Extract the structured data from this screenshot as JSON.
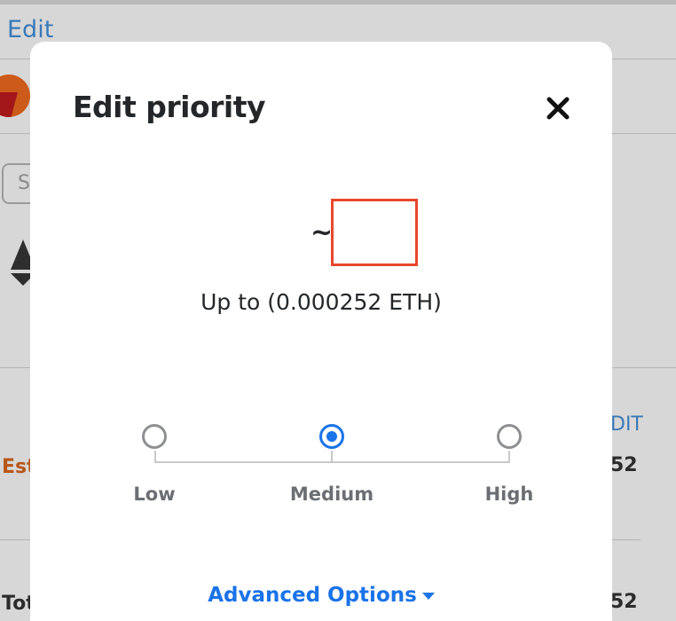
{
  "background": {
    "edit_link": "Edit",
    "search_fragment": "S",
    "estimated_fragment": "Est",
    "total_fragment": "Tot",
    "right_edit_fragment": "DIT",
    "right_value_1": "52",
    "right_value_2": "52",
    "icons": [
      "account-avatar-icon",
      "ethereum-icon"
    ]
  },
  "modal": {
    "title": "Edit priority",
    "close_icon": "close-icon",
    "fee_prefix": "~",
    "fee_max_label": "Up to (0.000252 ETH)",
    "priority_options": [
      {
        "label": "Low",
        "selected": false
      },
      {
        "label": "Medium",
        "selected": true
      },
      {
        "label": "High",
        "selected": false
      }
    ],
    "advanced_options_label": "Advanced Options",
    "advanced_icon": "caret-down-icon"
  },
  "colors": {
    "accent": "#1a73e8",
    "highlight_box": "#e8472c",
    "title_text": "#24272a",
    "label_text": "#6b6f73"
  }
}
